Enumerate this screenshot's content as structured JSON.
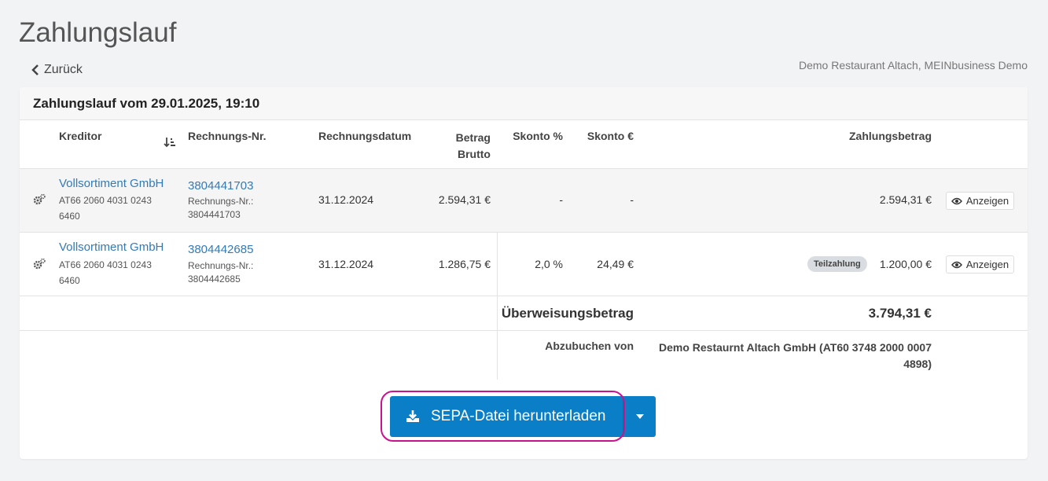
{
  "page": {
    "title": "Zahlungslauf",
    "back_label": "Zurück",
    "company": "Demo Restaurant Altach, MEINbusiness Demo"
  },
  "card": {
    "title": "Zahlungslauf vom 29.01.2025, 19:10"
  },
  "columns": {
    "kreditor": "Kreditor",
    "rechnungs_nr": "Rechnungs-Nr.",
    "rechnungsdatum": "Rechnungsdatum",
    "betrag_brutto_1": "Betrag",
    "betrag_brutto_2": "Brutto",
    "skonto_pct": "Skonto %",
    "skonto_eur": "Skonto €",
    "zahlungsbetrag": "Zahlungsbetrag"
  },
  "rows": [
    {
      "kreditor": "Vollsortiment GmbH",
      "iban_1": "AT66 2060 4031 0243",
      "iban_2": "6460",
      "rechnungs_nr": "3804441703",
      "rechnungs_nr_label": "Rechnungs-Nr.:",
      "rechnungs_nr_sub": "3804441703",
      "rechnungsdatum": "31.12.2024",
      "betrag_brutto": "2.594,31 €",
      "skonto_pct": "-",
      "skonto_eur": "-",
      "badge": "",
      "zahlungsbetrag": "2.594,31 €",
      "view_label": "Anzeigen"
    },
    {
      "kreditor": "Vollsortiment GmbH",
      "iban_1": "AT66 2060 4031 0243",
      "iban_2": "6460",
      "rechnungs_nr": "3804442685",
      "rechnungs_nr_label": "Rechnungs-Nr.:",
      "rechnungs_nr_sub": "3804442685",
      "rechnungsdatum": "31.12.2024",
      "betrag_brutto": "1.286,75 €",
      "skonto_pct": "2,0 %",
      "skonto_eur": "24,49 €",
      "badge": "Teilzahlung",
      "zahlungsbetrag": "1.200,00 €",
      "view_label": "Anzeigen"
    }
  ],
  "summary": {
    "transfer_label": "Überweisungsbetrag",
    "transfer_amount": "3.794,31 €",
    "debit_label": "Abzubuchen von",
    "debit_account_1": "Demo Restaurnt Altach GmbH (AT60 3748 2000 0007",
    "debit_account_2": "4898)"
  },
  "actions": {
    "download_label": "SEPA-Datei herunterladen"
  },
  "colors": {
    "accent": "#0b7ec8",
    "link": "#337ab7",
    "highlight": "#c8148c"
  },
  "icons": [
    "chevron-left-icon",
    "sort-icon",
    "gears-icon",
    "eye-icon",
    "download-icon",
    "caret-down-icon"
  ]
}
